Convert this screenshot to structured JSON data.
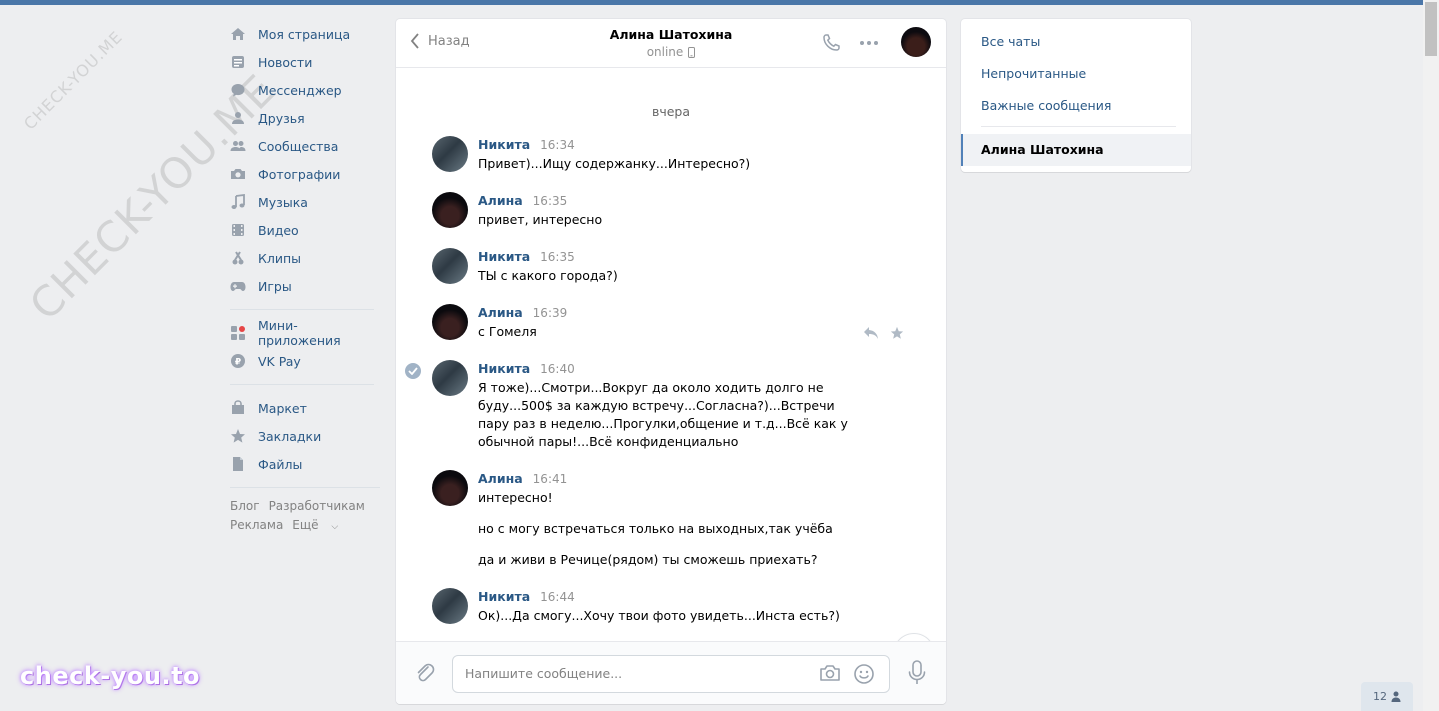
{
  "watermark": {
    "diagonal_small": "CHECK-YOU.ME",
    "diagonal_large": "CHECK-YOU.ME",
    "bottom_logo": "check-you.to"
  },
  "left_nav": {
    "primary": [
      {
        "label": "Моя страница",
        "icon": "home-icon"
      },
      {
        "label": "Новости",
        "icon": "news-icon"
      },
      {
        "label": "Мессенджер",
        "icon": "messenger-icon"
      },
      {
        "label": "Друзья",
        "icon": "friends-icon"
      },
      {
        "label": "Сообщества",
        "icon": "communities-icon"
      },
      {
        "label": "Фотографии",
        "icon": "camera-icon"
      },
      {
        "label": "Музыка",
        "icon": "music-icon"
      },
      {
        "label": "Видео",
        "icon": "video-icon"
      },
      {
        "label": "Клипы",
        "icon": "clips-icon"
      },
      {
        "label": "Игры",
        "icon": "gamepad-icon"
      }
    ],
    "secondary": [
      {
        "label": "Мини-приложения",
        "icon": "mini-apps-icon"
      },
      {
        "label": "VK Pay",
        "icon": "vkpay-icon"
      }
    ],
    "tertiary": [
      {
        "label": "Маркет",
        "icon": "market-icon"
      },
      {
        "label": "Закладки",
        "icon": "star-icon"
      },
      {
        "label": "Файлы",
        "icon": "file-icon"
      }
    ],
    "footer": {
      "blog": "Блог",
      "developers": "Разработчикам",
      "ads": "Реклама",
      "more": "Ещё"
    }
  },
  "chat": {
    "back_label": "Назад",
    "title": "Алина Шатохина",
    "status": "online",
    "day_separator": "вчера",
    "messages": [
      {
        "author": "Никита",
        "time": "16:34",
        "text": [
          "Привет)...Ищу содержанку...Интересно?)"
        ]
      },
      {
        "author": "Алина",
        "time": "16:35",
        "text": [
          "привет, интересно"
        ]
      },
      {
        "author": "Никита",
        "time": "16:35",
        "text": [
          "ТЫ с какого города?)"
        ]
      },
      {
        "author": "Алина",
        "time": "16:39",
        "text": [
          "с Гомеля"
        ]
      },
      {
        "author": "Никита",
        "time": "16:40",
        "text": [
          "Я тоже)...Смотри...Вокруг да около ходить долго не буду...500$ за каждую встречу...Согласна?)...Встречи пару раз в неделю...Прогулки,общение и т.д...Всё как у обычной пары!...Всё конфиденциально"
        ]
      },
      {
        "author": "Алина",
        "time": "16:41",
        "text": [
          "интересно!",
          "но с могу встречаться только на выходных,так учёба",
          "да и живи в Речице(рядом) ты сможешь приехать?"
        ]
      },
      {
        "author": "Никита",
        "time": "16:44",
        "text": [
          "Ок)...Да смогу...Хочу твои фото увидеть...Инста есть?)"
        ]
      }
    ],
    "composer": {
      "placeholder": "Напишите сообщение..."
    }
  },
  "right_panel": {
    "filters": [
      "Все чаты",
      "Непрочитанные",
      "Важные сообщения"
    ],
    "active_chat": "Алина Шатохина"
  },
  "bottom_badge": {
    "count": "12"
  },
  "colors": {
    "link": "#2a5885",
    "accent": "#4a76a8",
    "background": "#edeef0"
  }
}
